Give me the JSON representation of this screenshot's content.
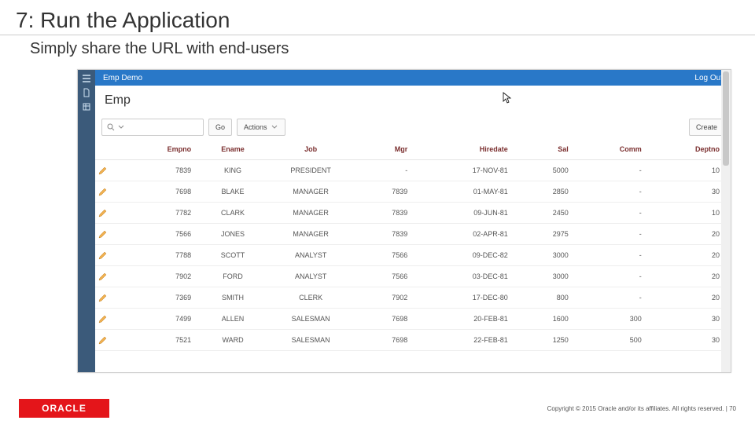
{
  "slide": {
    "title": "7: Run the Application",
    "subtitle": "Simply share the URL with end-users",
    "logo_text": "ORACLE",
    "copyright": "Copyright © 2015 Oracle and/or its affiliates. All rights reserved.   |",
    "page_number": "70"
  },
  "app": {
    "topbar": {
      "title": "Emp Demo",
      "logout": "Log Out"
    },
    "page_title": "Emp",
    "toolbar": {
      "go": "Go",
      "actions": "Actions",
      "create": "Create"
    },
    "columns": [
      "Empno",
      "Ename",
      "Job",
      "Mgr",
      "Hiredate",
      "Sal",
      "Comm",
      "Deptno"
    ],
    "rows": [
      {
        "empno": "7839",
        "ename": "KING",
        "job": "PRESIDENT",
        "mgr": "-",
        "hiredate": "17-NOV-81",
        "sal": "5000",
        "comm": "-",
        "deptno": "10"
      },
      {
        "empno": "7698",
        "ename": "BLAKE",
        "job": "MANAGER",
        "mgr": "7839",
        "hiredate": "01-MAY-81",
        "sal": "2850",
        "comm": "-",
        "deptno": "30"
      },
      {
        "empno": "7782",
        "ename": "CLARK",
        "job": "MANAGER",
        "mgr": "7839",
        "hiredate": "09-JUN-81",
        "sal": "2450",
        "comm": "-",
        "deptno": "10"
      },
      {
        "empno": "7566",
        "ename": "JONES",
        "job": "MANAGER",
        "mgr": "7839",
        "hiredate": "02-APR-81",
        "sal": "2975",
        "comm": "-",
        "deptno": "20"
      },
      {
        "empno": "7788",
        "ename": "SCOTT",
        "job": "ANALYST",
        "mgr": "7566",
        "hiredate": "09-DEC-82",
        "sal": "3000",
        "comm": "-",
        "deptno": "20"
      },
      {
        "empno": "7902",
        "ename": "FORD",
        "job": "ANALYST",
        "mgr": "7566",
        "hiredate": "03-DEC-81",
        "sal": "3000",
        "comm": "-",
        "deptno": "20"
      },
      {
        "empno": "7369",
        "ename": "SMITH",
        "job": "CLERK",
        "mgr": "7902",
        "hiredate": "17-DEC-80",
        "sal": "800",
        "comm": "-",
        "deptno": "20"
      },
      {
        "empno": "7499",
        "ename": "ALLEN",
        "job": "SALESMAN",
        "mgr": "7698",
        "hiredate": "20-FEB-81",
        "sal": "1600",
        "comm": "300",
        "deptno": "30"
      },
      {
        "empno": "7521",
        "ename": "WARD",
        "job": "SALESMAN",
        "mgr": "7698",
        "hiredate": "22-FEB-81",
        "sal": "1250",
        "comm": "500",
        "deptno": "30"
      }
    ]
  }
}
